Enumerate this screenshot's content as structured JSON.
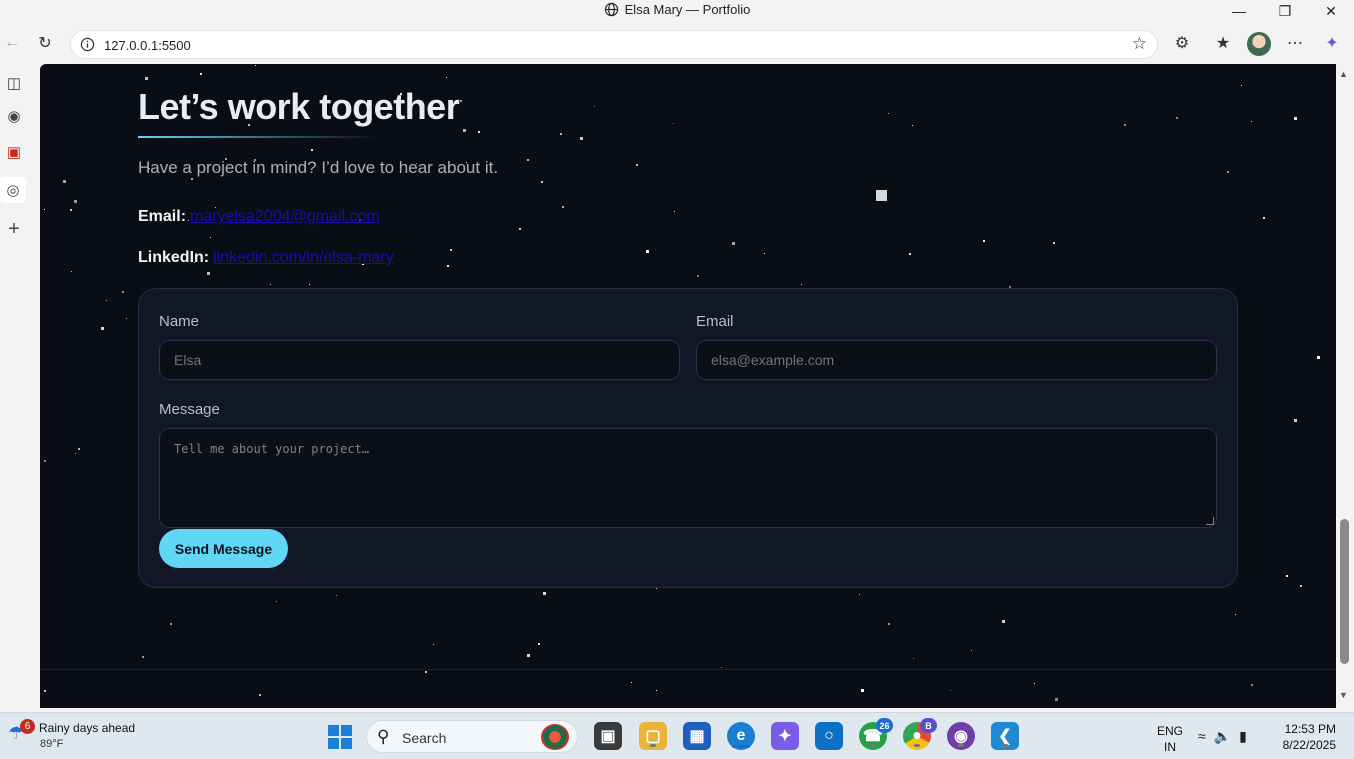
{
  "window": {
    "title": "Elsa Mary — Portfolio"
  },
  "browser": {
    "url": "127.0.0.1:5500"
  },
  "page": {
    "heading": "Let’s work together",
    "subheading": "Have a project in mind? I’d love to hear about it.",
    "email_label": "Email:",
    "email_value": "maryelsa2004@gmail.com",
    "linkedin_label": "LinkedIn:",
    "linkedin_value": "linkedin.com/in/elsa-mary"
  },
  "form": {
    "name_label": "Name",
    "name_placeholder": "Elsa",
    "email_label": "Email",
    "email_placeholder": "elsa@example.com",
    "message_label": "Message",
    "message_placeholder": "Tell me about your project…",
    "submit_label": "Send Message"
  },
  "colors": {
    "accent": "#62d6f5",
    "page_bg": "#0a0d14",
    "card_bg": "#111726",
    "link": "#1a0dab"
  },
  "taskbar": {
    "weather_text": "Rainy days ahead",
    "weather_temp": "89°F",
    "weather_badge": "6",
    "search_placeholder": "Search",
    "whatsapp_count": "26",
    "chrome_badge": "B",
    "lang_line1": "ENG",
    "lang_line2": "IN",
    "time": "12:53 PM",
    "date": "8/22/2025"
  }
}
